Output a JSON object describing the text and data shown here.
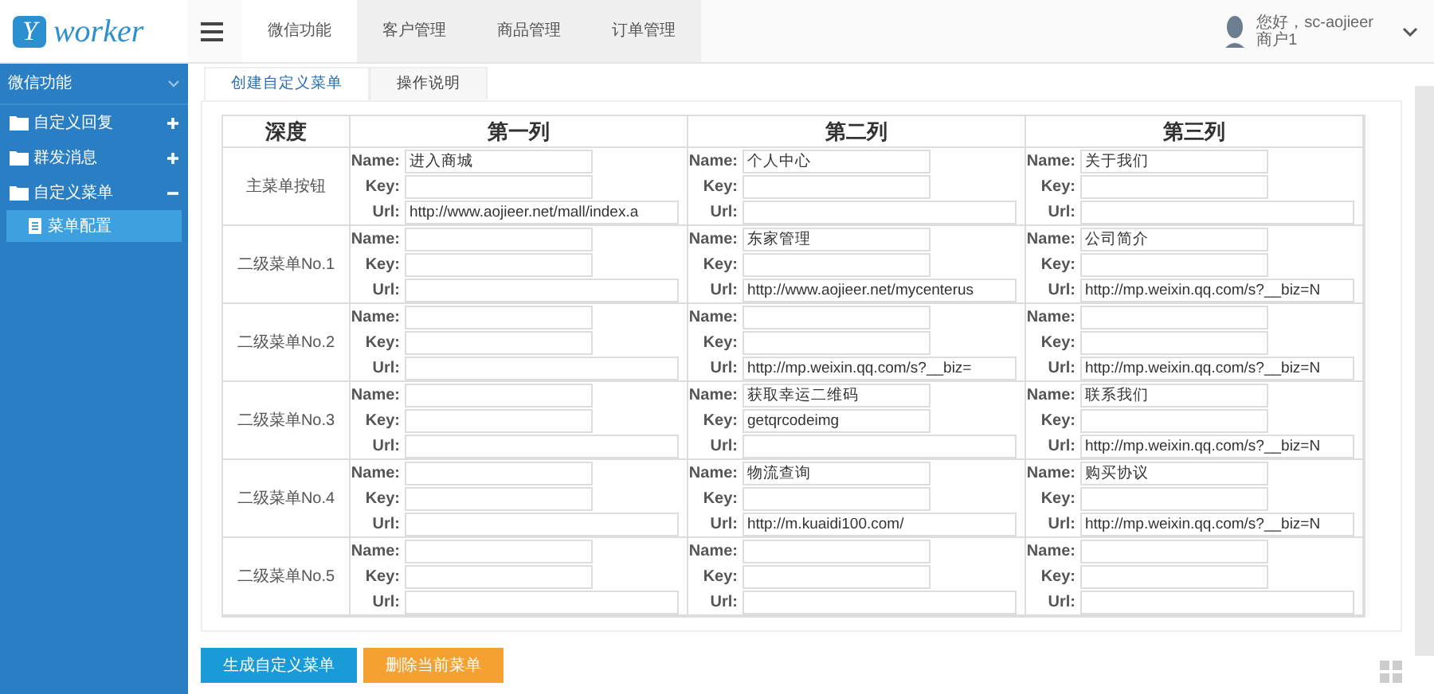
{
  "logo": {
    "letter": "Y",
    "word": "worker"
  },
  "nav": {
    "tabs": [
      {
        "label": "微信功能",
        "selected": true
      },
      {
        "label": "客户管理",
        "selected": false
      },
      {
        "label": "商品管理",
        "selected": false
      },
      {
        "label": "订单管理",
        "selected": false
      }
    ]
  },
  "user": {
    "greeting": "您好，sc-aojieer",
    "role": "商户1"
  },
  "sidebar": {
    "section": {
      "label": "微信功能",
      "expanded": true
    },
    "items": [
      {
        "label": "自定义回复",
        "expanded": false
      },
      {
        "label": "群发消息",
        "expanded": false
      },
      {
        "label": "自定义菜单",
        "expanded": true,
        "children": [
          {
            "label": "菜单配置",
            "selected": true
          }
        ]
      }
    ]
  },
  "content_tabs": [
    {
      "label": "创建自定义菜单",
      "selected": true
    },
    {
      "label": "操作说明",
      "selected": false
    }
  ],
  "table": {
    "columns": [
      "深度",
      "第一列",
      "第二列",
      "第三列"
    ],
    "rows": [
      {
        "label": "主菜单按钮",
        "cells": [
          [
            {
              "label": "Name:",
              "value": "进入商城"
            },
            {
              "label": "Key:"
            },
            {
              "label": "Url:",
              "value": "http://www.aojieer.net/mall/index.a"
            }
          ],
          [
            {
              "label": "Name:",
              "value": "个人中心"
            },
            {
              "label": "Key:"
            },
            {
              "label": "Url:"
            }
          ],
          [
            {
              "label": "Name:",
              "value": "关于我们"
            },
            {
              "label": "Key:"
            },
            {
              "label": "Url:"
            }
          ]
        ]
      },
      {
        "label": "二级菜单No.1",
        "cells": [
          [
            {
              "label": "Name:"
            },
            {
              "label": "Key:"
            },
            {
              "label": "Url:"
            }
          ],
          [
            {
              "label": "Name:",
              "value": "东家管理"
            },
            {
              "label": "Key:"
            },
            {
              "label": "Url:",
              "value": "http://www.aojieer.net/mycenterus"
            }
          ],
          [
            {
              "label": "Name:",
              "value": "公司简介"
            },
            {
              "label": "Key:"
            },
            {
              "label": "Url:",
              "value": "http://mp.weixin.qq.com/s?__biz=N"
            }
          ]
        ]
      },
      {
        "label": "二级菜单No.2",
        "cells": [
          [
            {
              "label": "Name:"
            },
            {
              "label": "Key:"
            },
            {
              "label": "Url:"
            }
          ],
          [
            {
              "label": "Name:"
            },
            {
              "label": "Key:"
            },
            {
              "label": "Url:",
              "value": "http://mp.weixin.qq.com/s?__biz="
            }
          ],
          [
            {
              "label": "Name:"
            },
            {
              "label": "Key:"
            },
            {
              "label": "Url:",
              "value": "http://mp.weixin.qq.com/s?__biz=N"
            }
          ]
        ]
      },
      {
        "label": "二级菜单No.3",
        "cells": [
          [
            {
              "label": "Name:"
            },
            {
              "label": "Key:"
            },
            {
              "label": "Url:"
            }
          ],
          [
            {
              "label": "Name:",
              "value": "获取幸运二维码"
            },
            {
              "label": "Key:",
              "value": "getqrcodeimg"
            },
            {
              "label": "Url:"
            }
          ],
          [
            {
              "label": "Name:",
              "value": "联系我们"
            },
            {
              "label": "Key:"
            },
            {
              "label": "Url:",
              "value": "http://mp.weixin.qq.com/s?__biz=N"
            }
          ]
        ]
      },
      {
        "label": "二级菜单No.4",
        "cells": [
          [
            {
              "label": "Name:"
            },
            {
              "label": "Key:"
            },
            {
              "label": "Url:"
            }
          ],
          [
            {
              "label": "Name:",
              "value": "物流查询"
            },
            {
              "label": "Key:"
            },
            {
              "label": "Url:",
              "value": "http://m.kuaidi100.com/"
            }
          ],
          [
            {
              "label": "Name:",
              "value": "购买协议"
            },
            {
              "label": "Key:"
            },
            {
              "label": "Url:",
              "value": "http://mp.weixin.qq.com/s?__biz=N"
            }
          ]
        ]
      },
      {
        "label": "二级菜单No.5",
        "cells": [
          [
            {
              "label": "Name:"
            },
            {
              "label": "Key:"
            },
            {
              "label": "Url:"
            }
          ],
          [
            {
              "label": "Name:"
            },
            {
              "label": "Key:"
            },
            {
              "label": "Url:"
            }
          ],
          [
            {
              "label": "Name:"
            },
            {
              "label": "Key:"
            },
            {
              "label": "Url:"
            }
          ]
        ]
      }
    ]
  },
  "buttons": [
    {
      "label": "生成自定义菜单",
      "kind": "primary"
    },
    {
      "label": "删除当前菜单",
      "kind": "warning"
    }
  ]
}
